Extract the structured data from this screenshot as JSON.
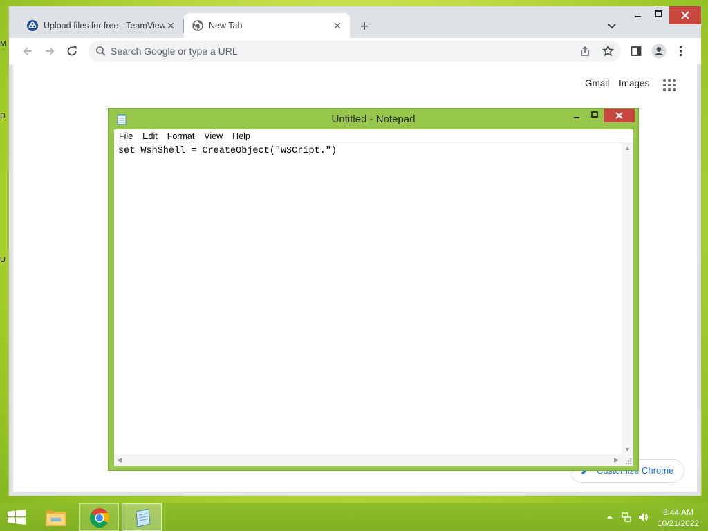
{
  "desktop": {
    "edge_fragments": [
      "M",
      "D",
      "U"
    ]
  },
  "browser": {
    "tabs": [
      {
        "title": "Upload files for free - TeamViewer",
        "active": false
      },
      {
        "title": "New Tab",
        "active": true
      }
    ],
    "new_tab_symbol": "+",
    "window_controls": {
      "minimize": "–",
      "maximize": "□",
      "close": "✕"
    },
    "omnibox": {
      "placeholder": "Search Google or type a URL",
      "value": ""
    },
    "new_tab_page": {
      "gmail_label": "Gmail",
      "images_label": "Images",
      "customize_label": "Customize Chrome"
    }
  },
  "notepad": {
    "title": "Untitled - Notepad",
    "menu": [
      "File",
      "Edit",
      "Format",
      "View",
      "Help"
    ],
    "text": "set WshShell = CreateObject(\"WSCript.\")",
    "controls": {
      "minimize": "–",
      "maximize": "□",
      "close": "✕"
    }
  },
  "taskbar": {
    "apps": [
      "start-icon",
      "file-explorer-icon",
      "chrome-icon",
      "notepad-icon"
    ],
    "clock": {
      "time": "8:44 AM",
      "date": "10/21/2022"
    }
  },
  "colors": {
    "desktop": "#b8d83a",
    "notepad_frame": "#96c74a",
    "close_red": "#c7463d",
    "chrome_frame": "#dee1e6",
    "link_blue": "#1a73e8"
  }
}
